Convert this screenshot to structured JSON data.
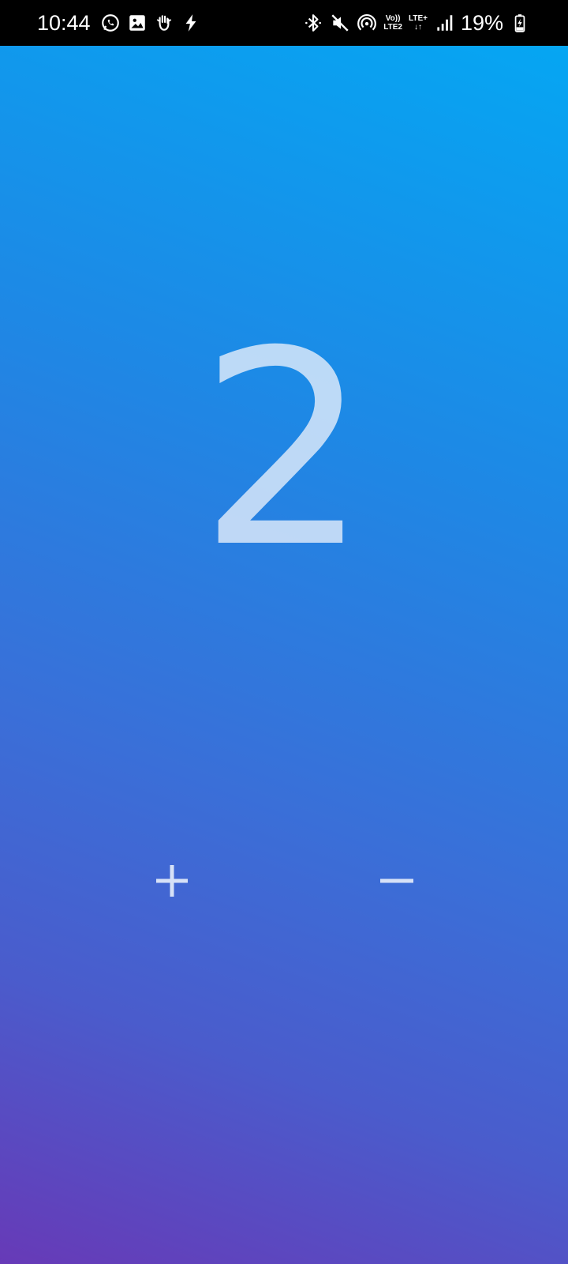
{
  "status_bar": {
    "time": "10:44",
    "network_top": "Vo))",
    "network_bottom": "LTE2",
    "lte_label": "LTE+",
    "battery_percent": "19%",
    "left_icons": [
      "whatsapp-icon",
      "gallery-icon",
      "hand-icon",
      "flash-icon"
    ],
    "right_icons": [
      "bluetooth-icon",
      "mute-icon",
      "hotspot-icon",
      "signal-icon",
      "battery-charging-icon"
    ]
  },
  "counter": {
    "value": "2"
  },
  "controls": {
    "increment_icon": "plus-icon",
    "decrement_icon": "minus-icon"
  },
  "colors": {
    "gradient_top": "#03a9f4",
    "gradient_bottom": "#673ab7",
    "text": "#dfe9fa"
  }
}
